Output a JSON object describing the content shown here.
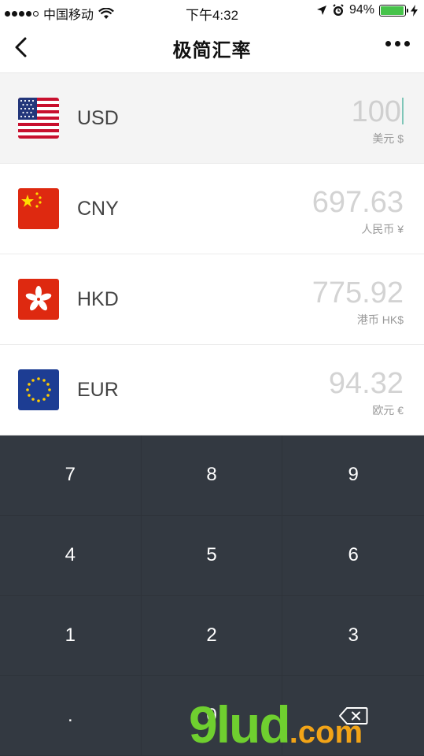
{
  "status": {
    "carrier": "中国移动",
    "time": "下午4:32",
    "battery": "94%"
  },
  "nav": {
    "title": "极简汇率"
  },
  "currencies": [
    {
      "code": "USD",
      "amount": "100",
      "name": "美元 $",
      "active": true,
      "flag": "us-flag-icon"
    },
    {
      "code": "CNY",
      "amount": "697.63",
      "name": "人民币 ¥",
      "active": false,
      "flag": "cn-flag-icon"
    },
    {
      "code": "HKD",
      "amount": "775.92",
      "name": "港币 HK$",
      "active": false,
      "flag": "hk-flag-icon"
    },
    {
      "code": "EUR",
      "amount": "94.32",
      "name": "欧元 €",
      "active": false,
      "flag": "eu-flag-icon"
    }
  ],
  "keypad": {
    "keys": [
      "7",
      "8",
      "9",
      "4",
      "5",
      "6",
      "1",
      "2",
      "3",
      ".",
      "0"
    ]
  },
  "watermark": {
    "brand": "9lud",
    "domain": ".com"
  },
  "colors": {
    "keypad_bg": "#333941",
    "active_row_bg": "#f4f4f4",
    "caret": "#7fc6b8"
  }
}
